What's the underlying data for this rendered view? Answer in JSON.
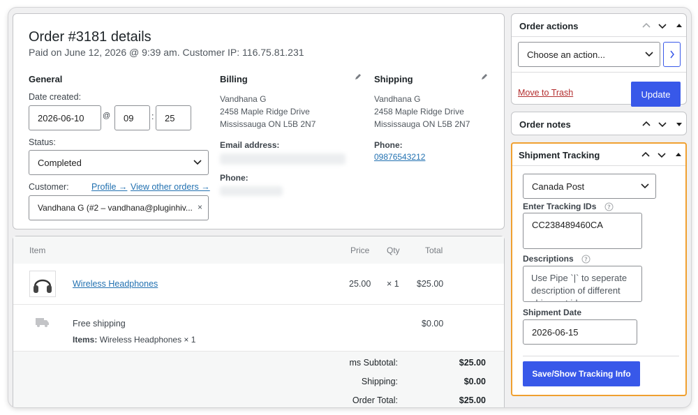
{
  "order": {
    "title": "Order #3181 details",
    "subtitle": "Paid on June 12, 2026 @ 9:39 am. Customer IP: 116.75.81.231"
  },
  "general": {
    "heading": "General",
    "date_label": "Date created:",
    "date_value": "2026-06-10",
    "at_sep": "@",
    "time_sep": ":",
    "hour": "09",
    "minute": "25",
    "status_label": "Status:",
    "status_value": "Completed",
    "customer_label": "Customer:",
    "profile_link": "Profile →",
    "other_orders_link": "View other orders →",
    "customer_value": "Vandhana G (#2 – vandhana@pluginhiv..."
  },
  "billing": {
    "heading": "Billing",
    "address": [
      "Vandhana G",
      "2458 Maple Ridge Drive",
      "Mississauga ON L5B 2N7"
    ],
    "email_label": "Email address:",
    "phone_label": "Phone:"
  },
  "shipping": {
    "heading": "Shipping",
    "address": [
      "Vandhana G",
      "2458 Maple Ridge Drive",
      "Mississauga ON L5B 2N7"
    ],
    "phone_label": "Phone:",
    "phone_value": "09876543212"
  },
  "items": {
    "headers": {
      "item": "Item",
      "price": "Price",
      "qty": "Qty",
      "total": "Total"
    },
    "rows": [
      {
        "name": "Wireless Headphones",
        "price": "25.00",
        "qty": "× 1",
        "total": "$25.00"
      }
    ],
    "shipping_row": {
      "name": "Free shipping",
      "items_label": "Items:",
      "items_value": "Wireless Headphones × 1",
      "total": "$0.00"
    },
    "totals": [
      {
        "label": "ms Subtotal:",
        "value": "$25.00"
      },
      {
        "label": "Shipping:",
        "value": "$0.00"
      },
      {
        "label": "Order Total:",
        "value": "$25.00"
      }
    ]
  },
  "order_actions": {
    "heading": "Order actions",
    "select_value": "Choose an action...",
    "trash_link": "Move to Trash",
    "update_button": "Update"
  },
  "order_notes": {
    "heading": "Order notes"
  },
  "tracking": {
    "heading": "Shipment Tracking",
    "carrier": "Canada Post",
    "ids_label": "Enter Tracking IDs",
    "ids_value": "CC238489460CA",
    "desc_label": "Descriptions",
    "desc_placeholder": "Use Pipe `|` to seperate description of different shipment ids",
    "date_label": "Shipment Date",
    "date_value": "2026-06-15",
    "save_button": "Save/Show Tracking Info"
  },
  "colors": {
    "accent": "#3858e9",
    "link": "#2271b1",
    "highlight_border": "#f0a030",
    "trash": "#b32d2e"
  }
}
